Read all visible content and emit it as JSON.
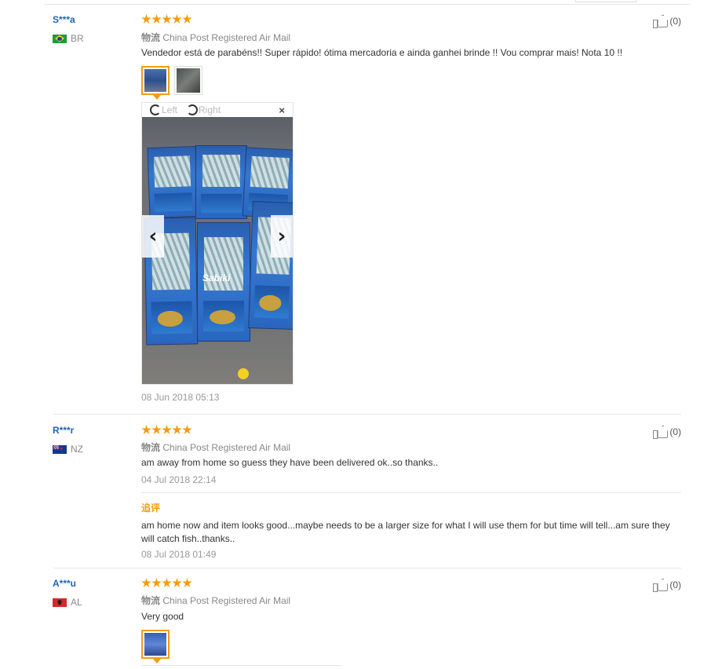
{
  "reviews": [
    {
      "user": "S***a",
      "country": "BR",
      "stars": 5,
      "logistics_label": "物流",
      "logistics": "China Post Registered Air Mail",
      "text": "Vendedor está de parabéns!! Super rápido! ótima mercadoria e ainda ganhei brinde !! Vou comprar mais! Nota 10 !!",
      "likes": "(0)",
      "viewer": {
        "rotate_left": "Left",
        "rotate_right": "Right",
        "close": "×",
        "prev": "‹",
        "next": "›",
        "brand": "Sabiki"
      },
      "date": "08 Jun 2018 05:13"
    },
    {
      "user": "R***r",
      "country": "NZ",
      "stars": 5,
      "logistics_label": "物流",
      "logistics": "China Post Registered Air Mail",
      "text": "am away from home so guess they have been delivered ok..so thanks..",
      "likes": "(0)",
      "date": "04 Jul 2018 22:14",
      "additional_label": "追评",
      "additional_text": "am home now and item looks good...maybe needs to be a larger size for what I will use them for but time will tell...am sure they will catch fish..thanks..",
      "additional_date": "08 Jul 2018 01:49"
    },
    {
      "user": "A***u",
      "country": "AL",
      "stars": 5,
      "logistics_label": "物流",
      "logistics": "China Post Registered Air Mail",
      "text": "Very good",
      "likes": "(0)"
    }
  ],
  "colors": {
    "accent": "#f39c12",
    "username": "#1d64b6"
  }
}
